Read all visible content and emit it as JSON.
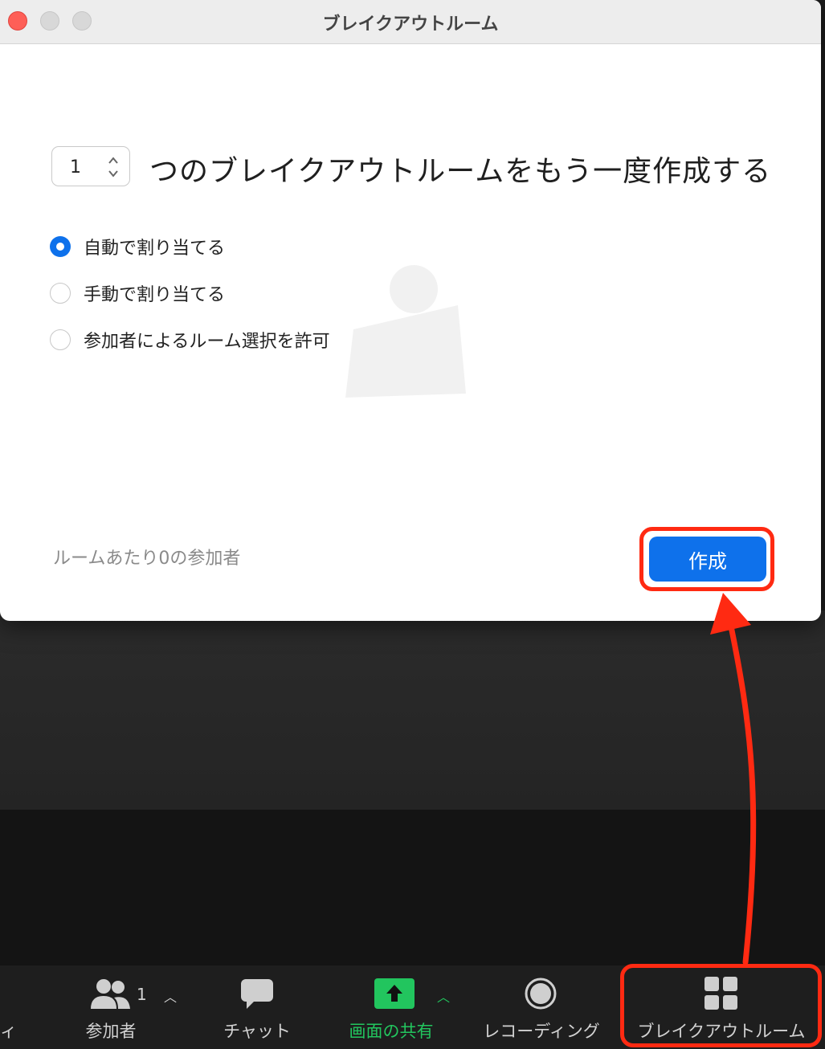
{
  "window": {
    "title": "ブレイクアウトルーム"
  },
  "dialog": {
    "room_count": "1",
    "headline": "つのブレイクアウトルームをもう一度作成する",
    "options": [
      {
        "label": "自動で割り当てる",
        "selected": true
      },
      {
        "label": "手動で割り当てる",
        "selected": false
      },
      {
        "label": "参加者によるルーム選択を許可",
        "selected": false
      }
    ],
    "participants_per_room": "ルームあたり0の参加者",
    "create_label": "作成"
  },
  "toolbar": {
    "edge_label": "ィ",
    "participants": {
      "label": "参加者",
      "count": "1",
      "icon": "participants-icon"
    },
    "chat": {
      "label": "チャット",
      "icon": "chat-icon"
    },
    "share": {
      "label": "画面の共有",
      "icon": "share-screen-icon"
    },
    "record": {
      "label": "レコーディング",
      "icon": "record-icon"
    },
    "breakout": {
      "label": "ブレイクアウトルーム",
      "icon": "breakout-grid-icon"
    }
  },
  "colors": {
    "accent": "#0e71eb",
    "share_green": "#22c55e",
    "annotation_red": "#ff2a12",
    "toolbar_bg": "#1e1e1e"
  }
}
